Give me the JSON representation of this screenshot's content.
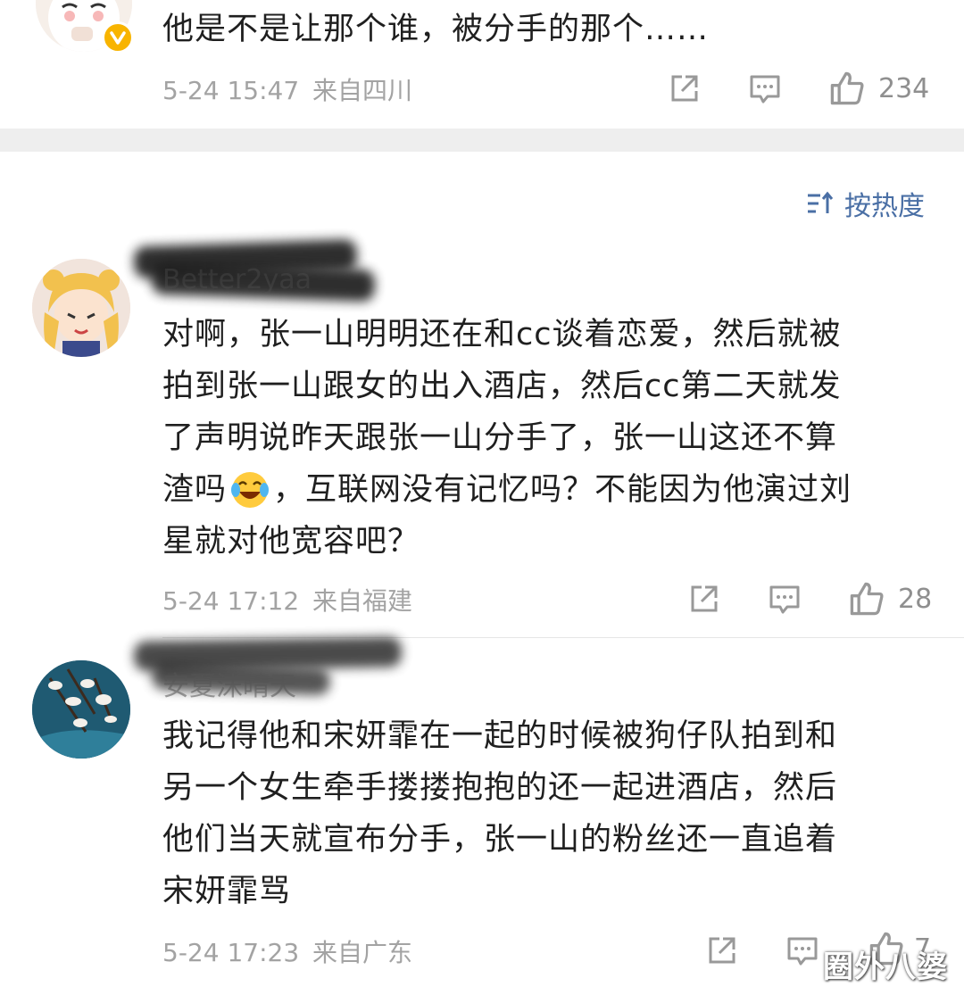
{
  "top_comment": {
    "text": "他是不是让那个谁，被分手的那个……",
    "time": "5-24 15:47",
    "location": "来自四川",
    "likes": "234",
    "icons": {
      "share": "share-icon",
      "reply": "comment-icon",
      "like": "thumbs-up-icon",
      "verified": "verified-badge-icon"
    }
  },
  "sort": {
    "label": "按热度",
    "icon": "sort-icon",
    "accent": "#4a6fa5"
  },
  "comments": [
    {
      "username": "Better2yaa",
      "lines": [
        "对啊，张一山明明还在和cc谈着恋爱，然后就被",
        "拍到张一山跟女的出入酒店，然后cc第二天就发",
        "了声明说昨天跟张一山分手了，张一山这还不算",
        "渣吗",
        "，互联网没有记忆吗？不能因为他演过刘",
        "星就对他宽容吧？"
      ],
      "emoji": "laugh-cry-emoji",
      "time": "5-24 17:12",
      "location": "来自福建",
      "likes": "28"
    },
    {
      "username": "安夏沫晴天",
      "lines": [
        "我记得他和宋妍霏在一起的时候被狗仔队拍到和",
        "另一个女生牵手搂搂抱抱的还一起进酒店，然后",
        "他们当天就宣布分手，张一山的粉丝还一直追着",
        "宋妍霏骂"
      ],
      "time": "5-24 17:23",
      "location": "来自广东",
      "likes": "7"
    }
  ],
  "watermark": "圈外八婆"
}
